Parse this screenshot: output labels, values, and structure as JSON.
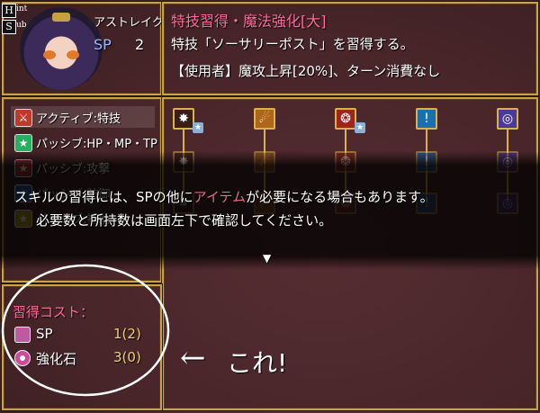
{
  "hint_keys": [
    {
      "key": "H",
      "label": "int"
    },
    {
      "key": "S",
      "label": "ub"
    }
  ],
  "character": {
    "name": "アストレイク",
    "sp_label": "SP",
    "sp_value": "2"
  },
  "skill_detail": {
    "title_prefix": "特技習得・魔法強化",
    "title_tag": "[大]",
    "line1": "特技「ソーサリーポスト」を習得する。",
    "line2": "【使用者】魔攻上昇[20%]、ターン消費なし"
  },
  "categories": [
    {
      "label": "アクティブ:特技",
      "icon": "sword-icon",
      "color": "#c0392b",
      "glyph": "⚔"
    },
    {
      "label": "パッシブ:HP・MP・TP",
      "icon": "star-icon",
      "color": "#27ae60",
      "glyph": "★"
    },
    {
      "label": "パッシブ:攻撃",
      "icon": "star-icon",
      "color": "#b0303a",
      "glyph": "★"
    },
    {
      "label": "パッシブ:防御",
      "icon": "star-icon",
      "color": "#2e62b8",
      "glyph": "★"
    },
    {
      "label": "パッシブ:補助",
      "icon": "star-icon",
      "color": "#b8a020",
      "glyph": "★"
    }
  ],
  "tree_columns": [
    {
      "icon": "flame-burst-icon",
      "bg": "#3a1e14",
      "glyph": "✸",
      "star": true
    },
    {
      "icon": "fire-slash-icon",
      "bg": "#b0661a",
      "glyph": "☄",
      "star": false
    },
    {
      "icon": "fire-orb-icon",
      "bg": "#a0231e",
      "glyph": "❂",
      "star": true
    },
    {
      "icon": "water-drop-icon",
      "bg": "#1a6fae",
      "glyph": "ǃ",
      "star": false
    },
    {
      "icon": "vortex-icon",
      "bg": "#4a3a9a",
      "glyph": "◎",
      "star": false
    }
  ],
  "message": {
    "line1_a": "スキルの習得には、SPの他に",
    "line1_hl": "アイテム",
    "line1_b": "が必要になる場合もあります。",
    "line2": "必要数と所持数は画面左下で確認してください。",
    "continue_glyph": "▼"
  },
  "cost": {
    "title": "習得コスト：",
    "items": [
      {
        "icon": "sp-scroll-icon",
        "label": "SP",
        "value": "1(2)"
      },
      {
        "icon": "enhance-stone-icon",
        "label": "強化石",
        "value": "3(0)"
      }
    ]
  },
  "annotation": {
    "arrow": "←",
    "text": "これ!"
  },
  "colors": {
    "frame_gold": "#c9a24a",
    "title_pink": "#ff6aa0",
    "highlight": "#e86a8a",
    "cost_value": "#f0d070"
  }
}
